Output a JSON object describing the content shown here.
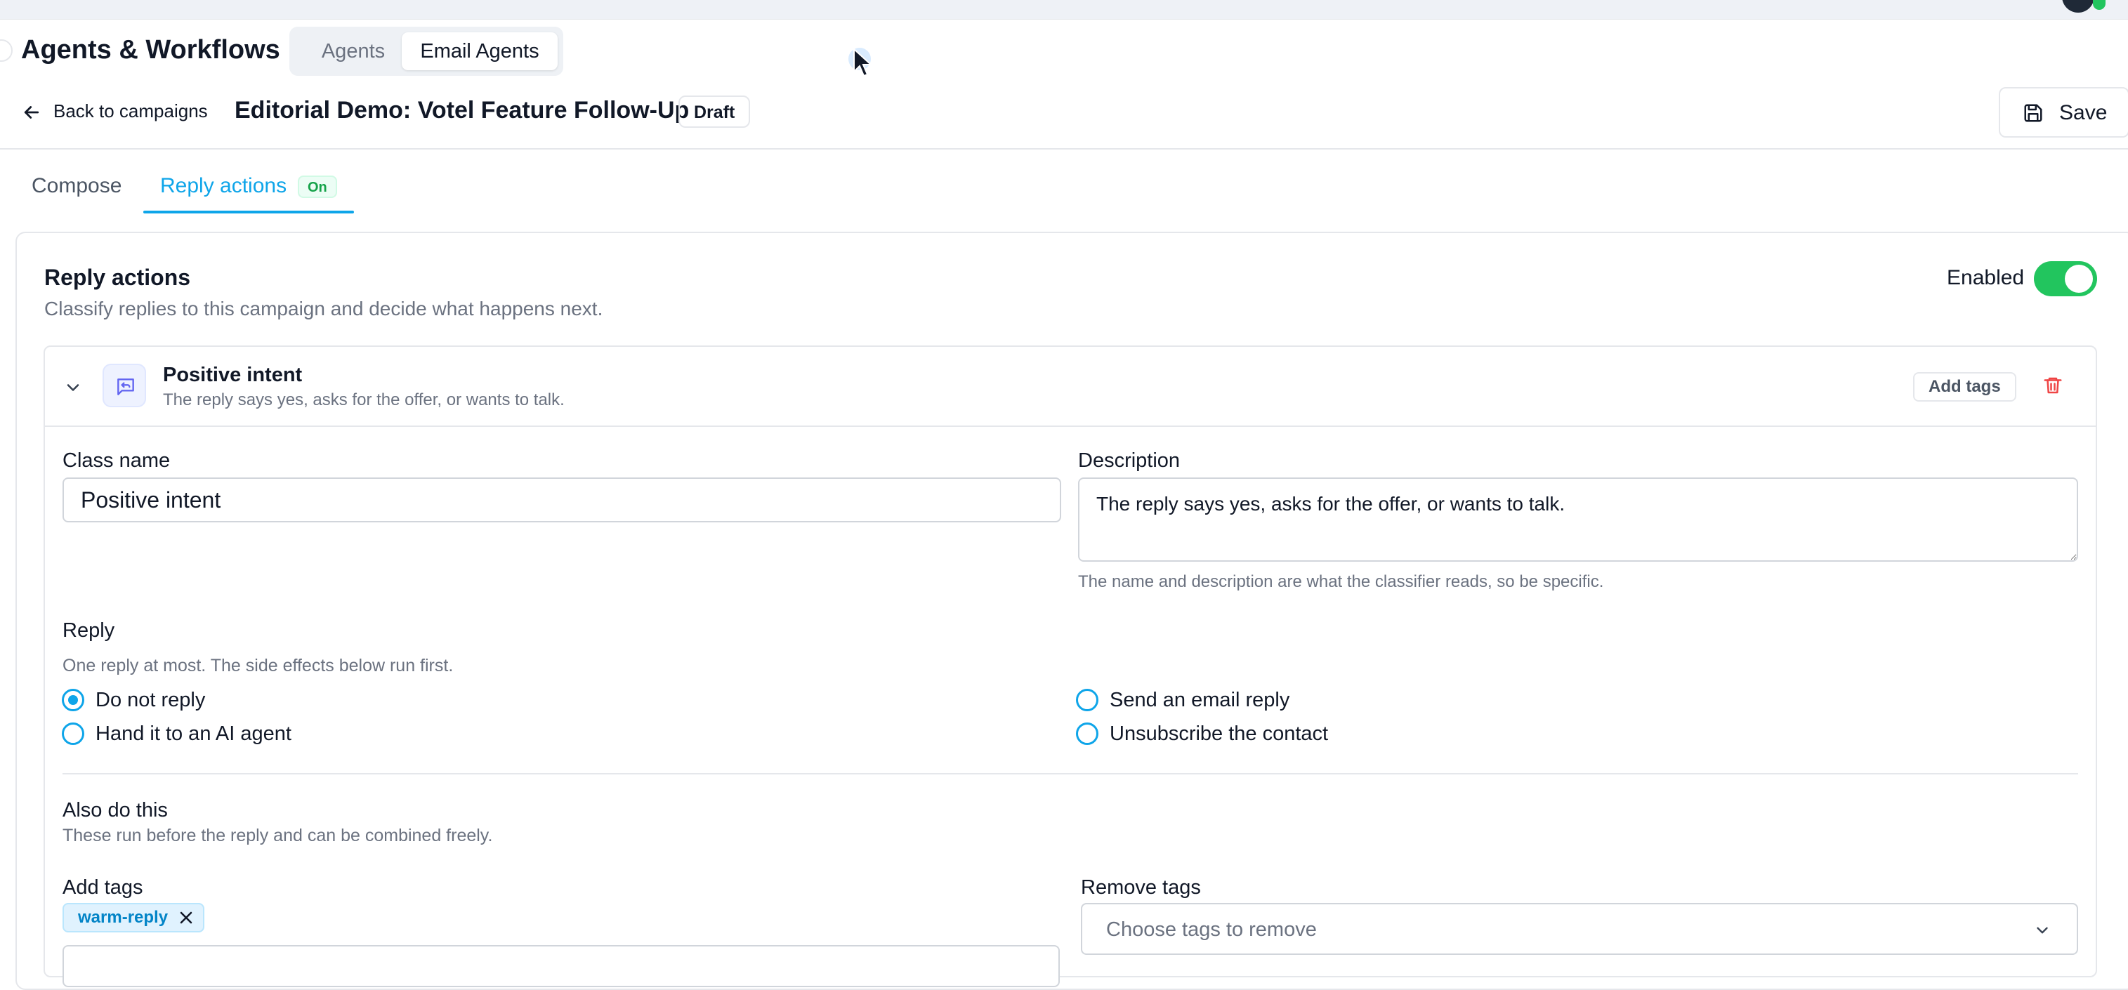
{
  "app": {
    "title": "Agents & Workflows",
    "segments": [
      {
        "label": "Agents",
        "active": false
      },
      {
        "label": "Email Agents",
        "active": true
      }
    ]
  },
  "header": {
    "back_label": "Back to campaigns",
    "campaign_title": "Editorial Demo: Votel Feature Follow-Up",
    "status_badge": "Draft",
    "save_label": "Save"
  },
  "tabs": [
    {
      "label": "Compose",
      "active": false
    },
    {
      "label": "Reply actions",
      "active": true,
      "badge": "On"
    }
  ],
  "reply_actions": {
    "title": "Reply actions",
    "subtitle": "Classify replies to this campaign and decide what happens next.",
    "enabled_label": "Enabled",
    "enabled": true
  },
  "class": {
    "name": "Positive intent",
    "description": "The reply says yes, asks for the offer, or wants to talk.",
    "add_tags_button": "Add tags",
    "form": {
      "class_name_label": "Class name",
      "class_name_value": "Positive intent",
      "description_label": "Description",
      "description_value": "The reply says yes, asks for the offer, or wants to talk.",
      "description_help": "The name and description are what the classifier reads, so be specific."
    },
    "reply": {
      "label": "Reply",
      "help": "One reply at most. The side effects below run first.",
      "options": [
        {
          "label": "Do not reply",
          "checked": true
        },
        {
          "label": "Hand it to an AI agent",
          "checked": false
        },
        {
          "label": "Send an email reply",
          "checked": false
        },
        {
          "label": "Unsubscribe the contact",
          "checked": false
        }
      ]
    },
    "also": {
      "label": "Also do this",
      "help": "These run before the reply and can be combined freely.",
      "add_tags_label": "Add tags",
      "tags": [
        "warm-reply"
      ],
      "remove_tags_label": "Remove tags",
      "remove_tags_placeholder": "Choose tags to remove"
    }
  },
  "colors": {
    "accent": "#0ea5e9",
    "toggle_on": "#22c55e",
    "danger": "#ef4444",
    "badge_on_text": "#16a34a"
  },
  "icons": [
    "arrow-left-icon",
    "save-icon",
    "chevron-down-icon",
    "message-reply-icon",
    "trash-icon",
    "close-icon",
    "cursor-icon"
  ]
}
